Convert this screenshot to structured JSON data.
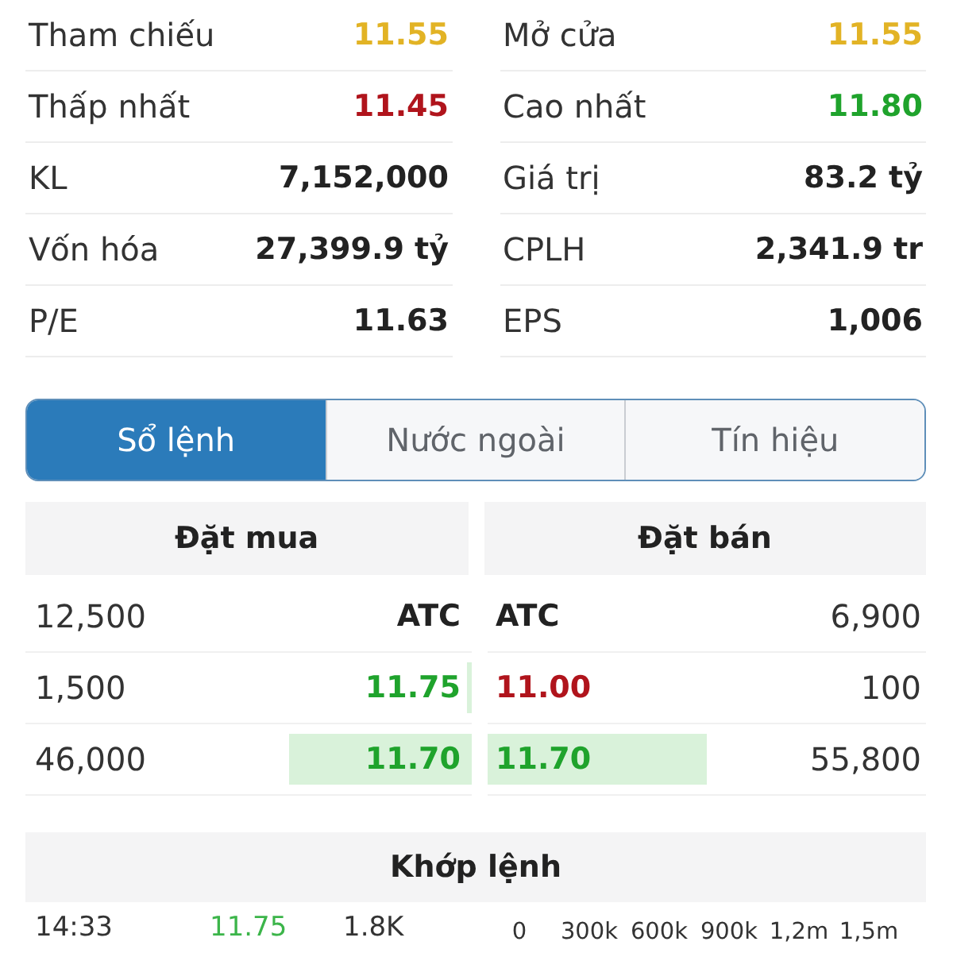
{
  "stats": [
    {
      "label": "Tham chiếu",
      "value": "11.55",
      "color": "#e2b325"
    },
    {
      "label": "Mở cửa",
      "value": "11.55",
      "color": "#e2b325"
    },
    {
      "label": "Thấp nhất",
      "value": "11.45",
      "color": "#b0141c"
    },
    {
      "label": "Cao nhất",
      "value": "11.80",
      "color": "#1fa32c"
    },
    {
      "label": "KL",
      "value": "7,152,000",
      "color": "#222222"
    },
    {
      "label": "Giá trị",
      "value": "83.2 tỷ",
      "color": "#222222"
    },
    {
      "label": "Vốn hóa",
      "value": "27,399.9 tỷ",
      "color": "#222222"
    },
    {
      "label": "CPLH",
      "value": "2,341.9 tr",
      "color": "#222222"
    },
    {
      "label": "P/E",
      "value": "11.63",
      "color": "#222222"
    },
    {
      "label": "EPS",
      "value": "1,006",
      "color": "#222222"
    }
  ],
  "tabs": [
    {
      "label": "Sổ lệnh",
      "selected": true
    },
    {
      "label": "Nước ngoài",
      "selected": false
    },
    {
      "label": "Tín hiệu",
      "selected": false
    }
  ],
  "order_book": {
    "headers": [
      "Đặt mua",
      "Đặt bán"
    ],
    "rows": [
      {
        "bid": {
          "volume": "12,500",
          "price": "ATC",
          "color": "#222222"
        },
        "ask": {
          "price": "ATC",
          "color": "#222222",
          "volume": "6,900"
        }
      },
      {
        "bid": {
          "volume": "1,500",
          "price": "11.75",
          "color": "#1fa32c",
          "level": 0.012
        },
        "ask": {
          "price": "11.00",
          "color": "#b0141c",
          "volume": "100"
        }
      },
      {
        "bid": {
          "volume": "46,000",
          "price": "11.70",
          "color": "#1fa32c",
          "level": 0.41
        },
        "ask": {
          "price": "11.70",
          "color": "#1fa32c",
          "volume": "55,800",
          "level": 0.5
        }
      }
    ]
  },
  "matched": {
    "title": "Khớp lệnh",
    "trades": [
      {
        "time": "14:33",
        "price": "11.75",
        "color": "#3cb54a",
        "volume": "1.8K"
      }
    ],
    "axis_ticks": [
      "0",
      "300k",
      "600k",
      "900k",
      "1,2m",
      "1,5m"
    ]
  }
}
